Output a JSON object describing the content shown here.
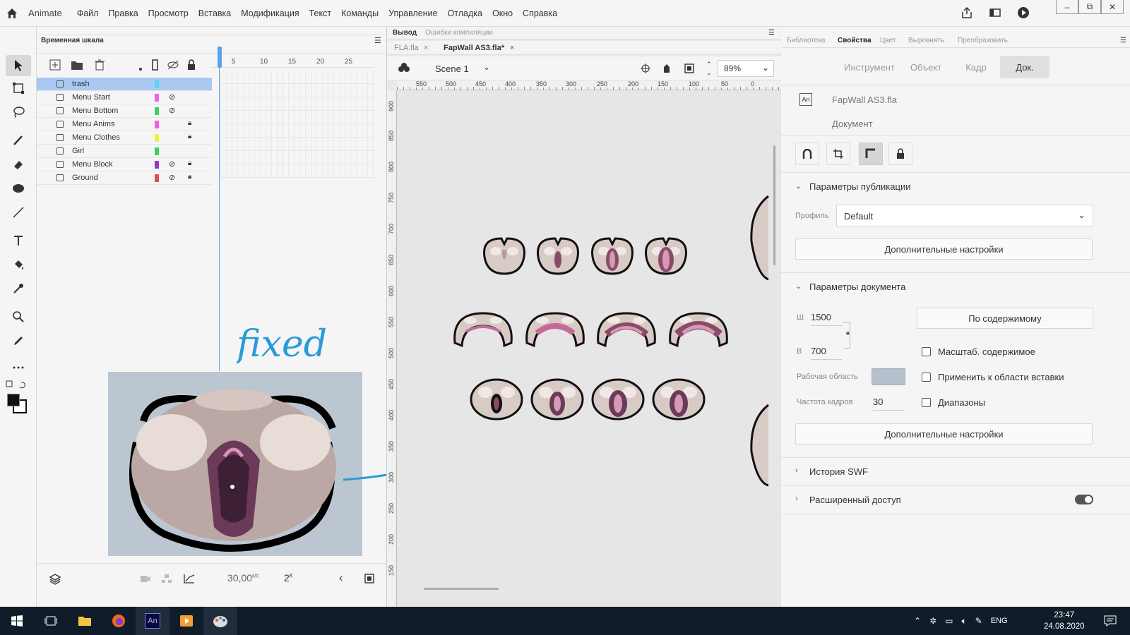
{
  "app": {
    "name": "Animate",
    "menu": [
      "Файл",
      "Правка",
      "Просмотр",
      "Вставка",
      "Модификация",
      "Текст",
      "Команды",
      "Управление",
      "Отладка",
      "Окно",
      "Справка"
    ]
  },
  "timeline": {
    "title": "Временная шкала",
    "ruler_numbers": [
      "5",
      "10",
      "15",
      "20",
      "25"
    ],
    "layers": [
      {
        "name": "trash",
        "color": "#5ad2f5",
        "hidden": false,
        "locked": false,
        "selected": true
      },
      {
        "name": "Menu Start",
        "color": "#f060e0",
        "hidden": true,
        "locked": false,
        "selected": false
      },
      {
        "name": "Menu Bottom",
        "color": "#40d060",
        "hidden": true,
        "locked": false,
        "selected": false
      },
      {
        "name": "Menu Anims",
        "color": "#f060e0",
        "hidden": false,
        "locked": true,
        "selected": false
      },
      {
        "name": "Menu Clothes",
        "color": "#f0f040",
        "hidden": false,
        "locked": true,
        "selected": false
      },
      {
        "name": "Girl",
        "color": "#40d060",
        "hidden": false,
        "locked": false,
        "selected": false
      },
      {
        "name": "Menu Block",
        "color": "#8a40c0",
        "hidden": true,
        "locked": true,
        "selected": false
      },
      {
        "name": "Ground",
        "color": "#e05050",
        "hidden": true,
        "locked": true,
        "selected": false
      }
    ],
    "fps": "30,00",
    "fps_unit": "к/с",
    "frame": "2",
    "frame_unit": "К"
  },
  "annotation": {
    "handwritten_text": "fixed"
  },
  "stage": {
    "output_tabs": [
      "Вывод",
      "Ошибки компиляции"
    ],
    "doc_tabs": [
      "FLA.fla",
      "FapWall AS3.fla*"
    ],
    "scene": "Scene 1",
    "zoom": "89%",
    "hruler_labels": [
      "550",
      "500",
      "450",
      "400",
      "350",
      "300",
      "250",
      "200",
      "150",
      "100",
      "50",
      "0"
    ],
    "vruler_labels": [
      "900",
      "850",
      "800",
      "750",
      "700",
      "650",
      "600",
      "550",
      "500",
      "450",
      "400",
      "350",
      "300",
      "250",
      "200",
      "150"
    ]
  },
  "properties": {
    "tabs": [
      "Библиотека",
      "Свойства",
      "Цвет",
      "Выровнять",
      "Преобразовать"
    ],
    "active_tab": "Свойства",
    "segments": [
      "Инструмент",
      "Объект",
      "Кадр",
      "Док."
    ],
    "active_segment": "Док.",
    "doc_icon_label": "An",
    "file_name": "FapWall AS3.fla",
    "doc_type": "Документ",
    "publish_section": "Параметры публикации",
    "profile_label": "Профиль",
    "profile_value": "Default",
    "advanced_settings": "Дополнительные настройки",
    "document_section": "Параметры документа",
    "width_label": "Ш",
    "width_value": "1500",
    "height_label": "В",
    "height_value": "700",
    "fit_content": "По содержимому",
    "scale_content": "Масштаб. содержимое",
    "apply_paste": "Применить к области вставки",
    "ranges": "Диапазоны",
    "stage_label": "Рабочая область",
    "stage_color": "#b4c0cc",
    "fps_label": "Частота кадров",
    "fps_value": "30",
    "advanced_settings2": "Дополнительные настройки",
    "swf_history": "История SWF",
    "extended_access": "Расширенный доступ"
  },
  "taskbar": {
    "lang": "ENG",
    "time": "23:47",
    "date": "24.08.2020"
  }
}
